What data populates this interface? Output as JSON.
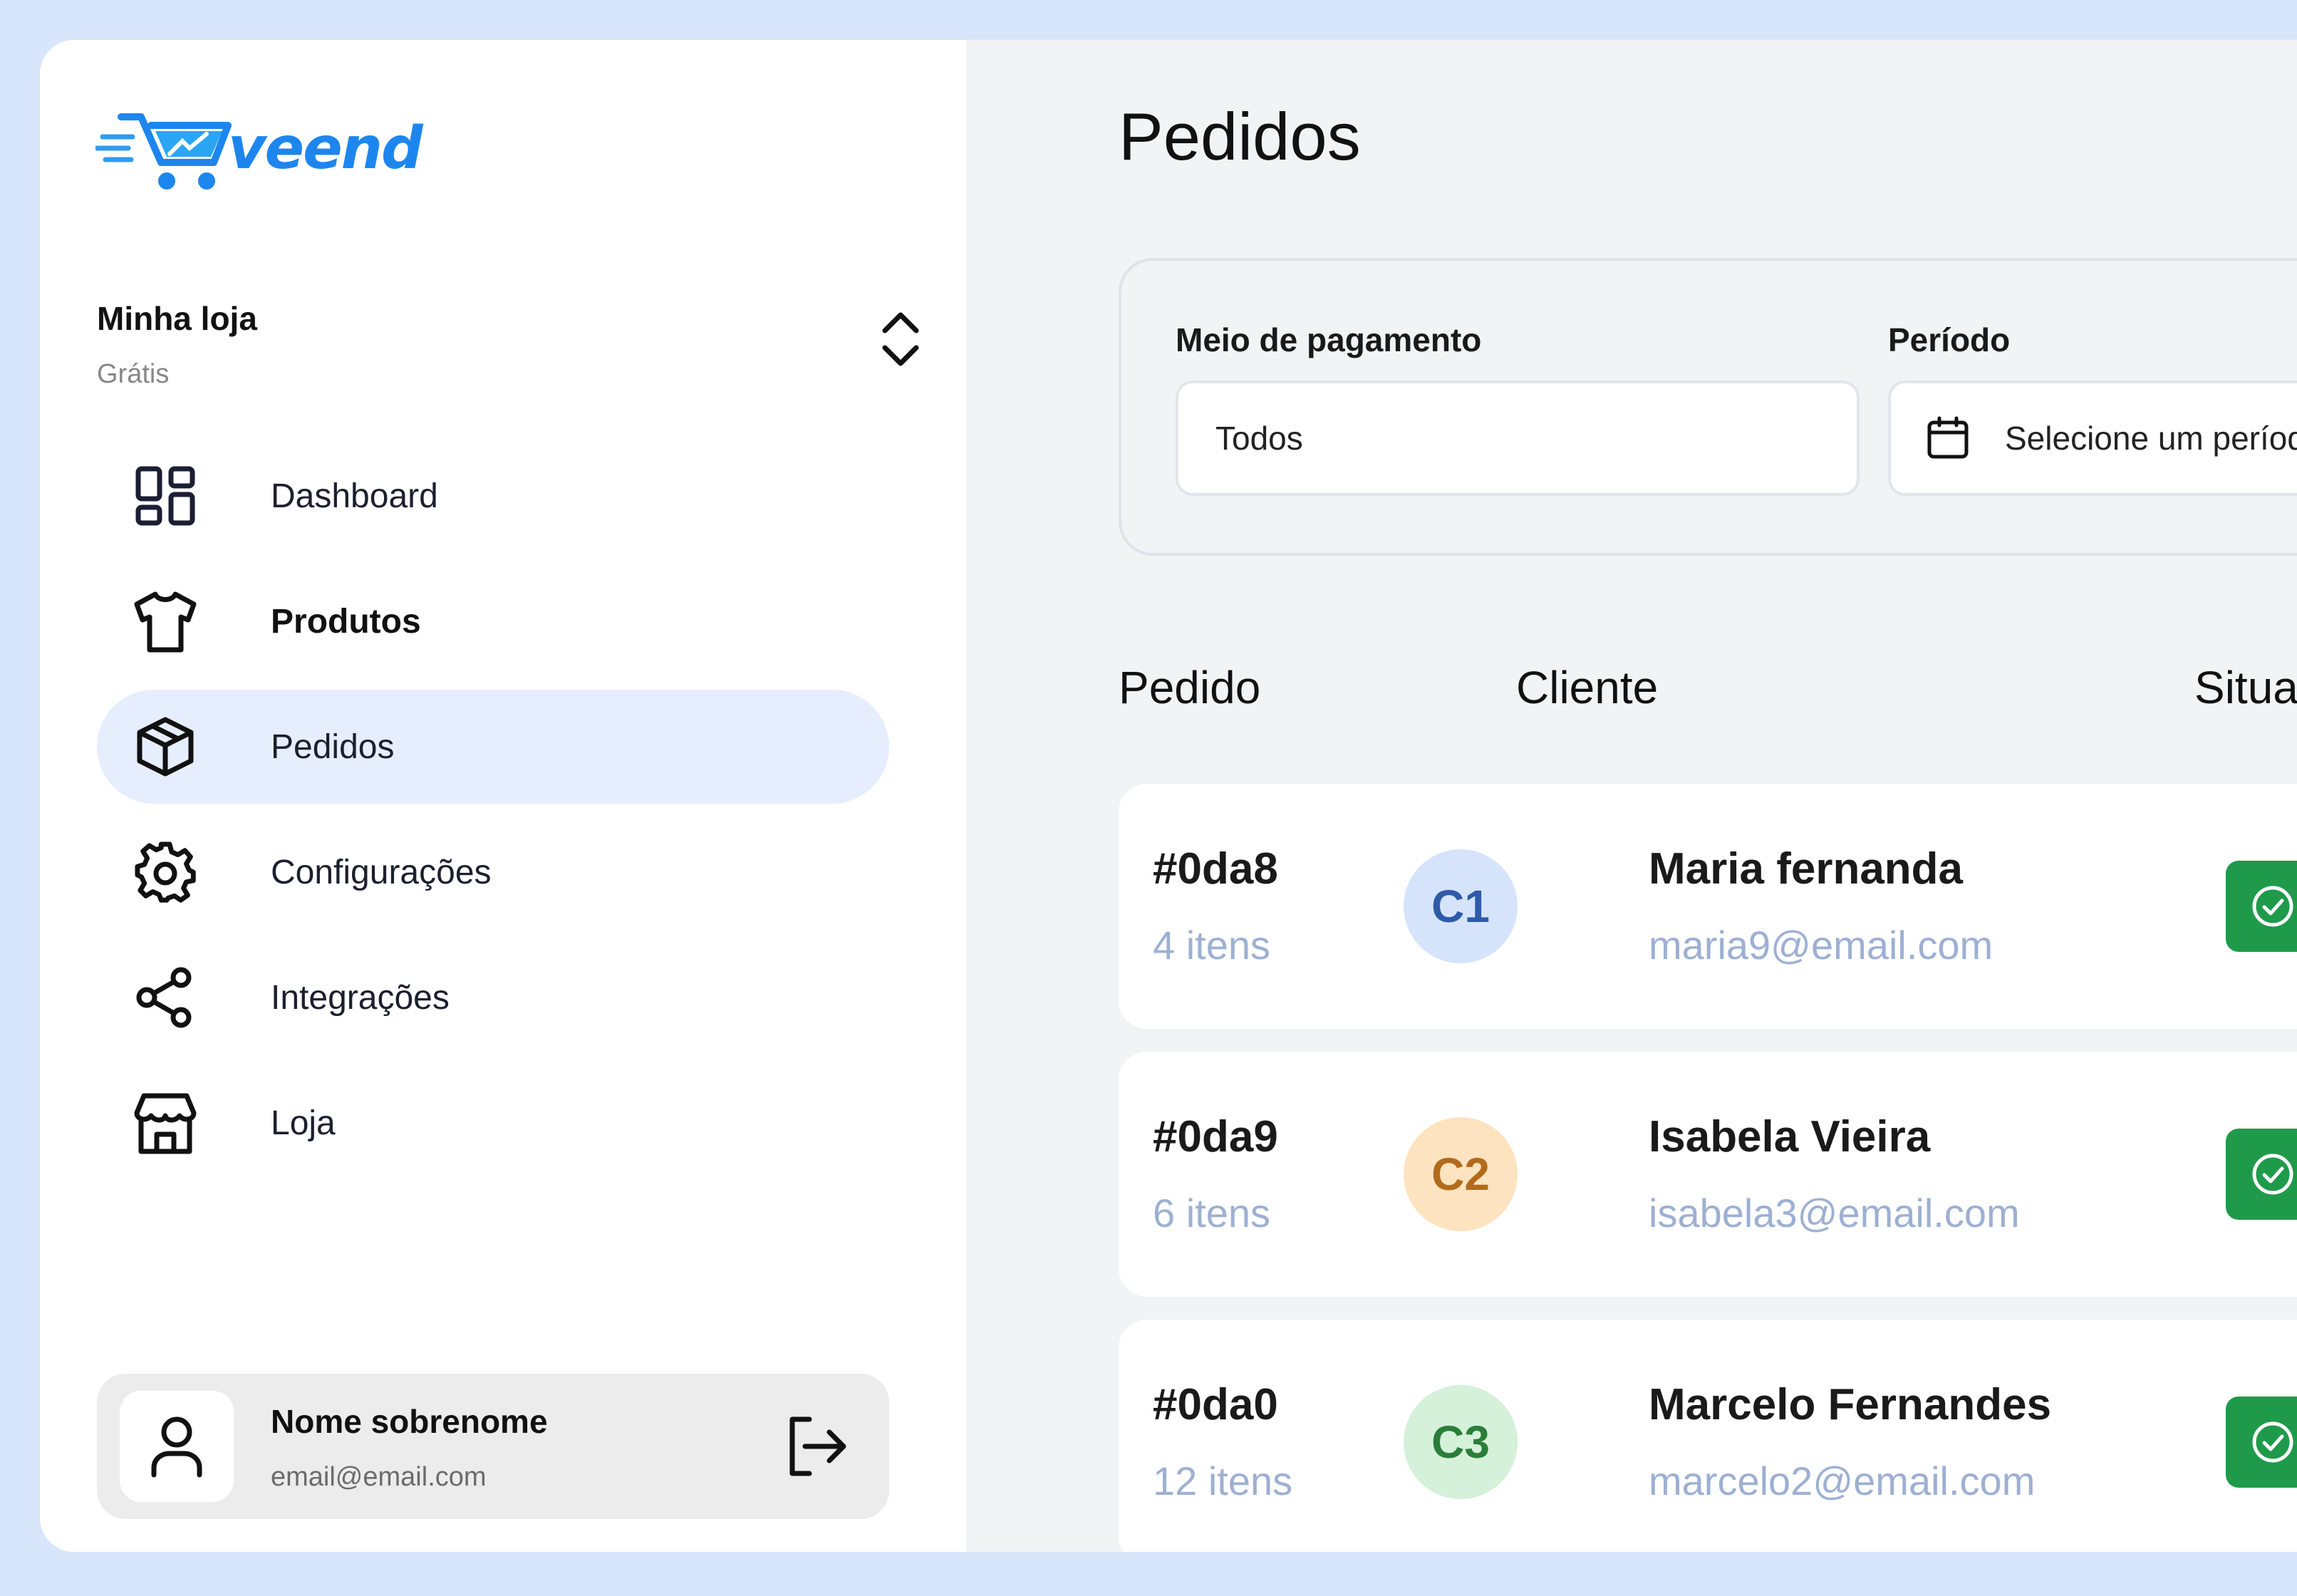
{
  "brand": {
    "name": "veend",
    "color": "#1d86ee"
  },
  "store": {
    "name": "Minha loja",
    "plan": "Grátis"
  },
  "nav": {
    "items": [
      {
        "label": "Dashboard",
        "icon": "dashboard-icon",
        "active": false
      },
      {
        "label": "Produtos",
        "icon": "shirt-icon",
        "active": false
      },
      {
        "label": "Pedidos",
        "icon": "box-icon",
        "active": true
      },
      {
        "label": "Configurações",
        "icon": "gear-icon",
        "active": false
      },
      {
        "label": "Integrações",
        "icon": "share-icon",
        "active": false
      },
      {
        "label": "Loja",
        "icon": "store-icon",
        "active": false
      }
    ]
  },
  "user": {
    "name": "Nome sobrenome",
    "email": "email@email.com"
  },
  "page": {
    "title": "Pedidos"
  },
  "filters": {
    "payment": {
      "label": "Meio de pagamento",
      "value": "Todos"
    },
    "period": {
      "label": "Período",
      "placeholder": "Selecione um período"
    }
  },
  "table": {
    "headers": {
      "order": "Pedido",
      "customer": "Cliente",
      "status": "Situação"
    },
    "rows": [
      {
        "id": "#0da8",
        "items": "4 itens",
        "initials": "C1",
        "name": "Maria fernanda",
        "email": "maria9@email.com",
        "avatar_bg": "#d6e4fb",
        "avatar_fg": "#2f5aa8",
        "status": "success"
      },
      {
        "id": "#0da9",
        "items": "6 itens",
        "initials": "C2",
        "name": "Isabela Vieira",
        "email": "isabela3@email.com",
        "avatar_bg": "#fde3bf",
        "avatar_fg": "#b26b1c",
        "status": "success"
      },
      {
        "id": "#0da0",
        "items": "12 itens",
        "initials": "C3",
        "name": "Marcelo Fernandes",
        "email": "marcelo2@email.com",
        "avatar_bg": "#d5f1d9",
        "avatar_fg": "#2b7d3a",
        "status": "success"
      }
    ]
  },
  "colors": {
    "active_nav_bg": "#e6eefd",
    "status_success": "#1f9a4a",
    "muted_text": "#9db0d3"
  }
}
